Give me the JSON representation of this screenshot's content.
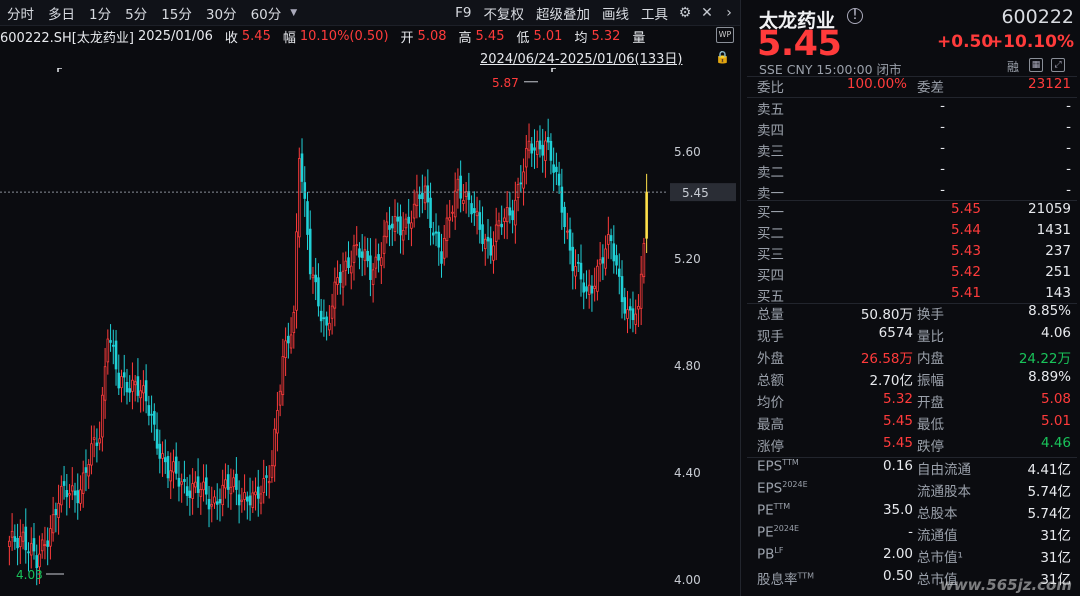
{
  "toolbar": {
    "periods": [
      "分时",
      "多日",
      "1分",
      "5分",
      "15分",
      "30分",
      "60分"
    ],
    "right_items": [
      "F9",
      "不复权",
      "超级叠加",
      "画线",
      "工具"
    ],
    "icons": [
      "gear-icon",
      "close-icon",
      "chevron-right-icon",
      "dropdown-icon"
    ]
  },
  "infobar": {
    "symbol": "600222.SH[太龙药业]",
    "date": "2025/01/06",
    "close_label": "收",
    "close": "5.45",
    "amp_label": "幅",
    "amp": "10.10%(0.50)",
    "open_label": "开",
    "open": "5.08",
    "high_label": "高",
    "high": "5.45",
    "low_label": "低",
    "low": "5.01",
    "avg_label": "均",
    "avg": "5.32",
    "vol_label": "量",
    "wp": "WP"
  },
  "range": "2024/06/24-2025/01/06(133日)",
  "chart_data": {
    "type": "candlestick",
    "symbol": "600222.SH",
    "y_ticks": [
      "5.60",
      "5.20",
      "4.80",
      "4.40",
      "4.00"
    ],
    "ylim": [
      4.0,
      5.87
    ],
    "current_price_label": "5.45",
    "high_label": "5.87",
    "low_label": "4.03",
    "colors": {
      "up": "#ff3b3b",
      "down": "#20d0d6",
      "last": "#ffe14a"
    }
  },
  "quote": {
    "name": "太龙药业",
    "code": "600222",
    "price": "5.45",
    "change": "+0.50",
    "change_pct": "+10.10%",
    "sub": "SSE  CNY  15:00:00  闭市",
    "rong": "融",
    "weibi_label": "委比",
    "weibi": "100.00%",
    "weicha_label": "委差",
    "weicha": "23121",
    "asks": [
      {
        "label": "卖五",
        "price": "-",
        "vol": "-"
      },
      {
        "label": "卖四",
        "price": "-",
        "vol": "-"
      },
      {
        "label": "卖三",
        "price": "-",
        "vol": "-"
      },
      {
        "label": "卖二",
        "price": "-",
        "vol": "-"
      },
      {
        "label": "卖一",
        "price": "-",
        "vol": "-"
      }
    ],
    "bids": [
      {
        "label": "买一",
        "price": "5.45",
        "vol": "21059"
      },
      {
        "label": "买二",
        "price": "5.44",
        "vol": "1431"
      },
      {
        "label": "买三",
        "price": "5.43",
        "vol": "237"
      },
      {
        "label": "买四",
        "price": "5.42",
        "vol": "251"
      },
      {
        "label": "买五",
        "price": "5.41",
        "vol": "143"
      }
    ],
    "stats": [
      {
        "l1": "总量",
        "v1": "50.80万",
        "c1": "white",
        "l2": "换手",
        "v2": "8.85%",
        "c2": "white"
      },
      {
        "l1": "现手",
        "v1": "6574",
        "c1": "white",
        "l2": "量比",
        "v2": "4.06",
        "c2": "white"
      },
      {
        "l1": "外盘",
        "v1": "26.58万",
        "c1": "red",
        "l2": "内盘",
        "v2": "24.22万",
        "c2": "green"
      },
      {
        "l1": "总额",
        "v1": "2.70亿",
        "c1": "white",
        "l2": "振幅",
        "v2": "8.89%",
        "c2": "white"
      },
      {
        "l1": "均价",
        "v1": "5.32",
        "c1": "red",
        "l2": "开盘",
        "v2": "5.08",
        "c2": "red"
      },
      {
        "l1": "最高",
        "v1": "5.45",
        "c1": "red",
        "l2": "最低",
        "v2": "5.01",
        "c2": "red"
      },
      {
        "l1": "涨停",
        "v1": "5.45",
        "c1": "red",
        "l2": "跌停",
        "v2": "4.46",
        "c2": "green"
      }
    ],
    "fundamentals": [
      {
        "l1": "EPS",
        "s1": "TTM",
        "v1": "0.16",
        "l2": "自由流通",
        "v2": "4.41亿"
      },
      {
        "l1": "EPS",
        "s1": "2024E",
        "v1": "",
        "l2": "流通股本",
        "v2": "5.74亿"
      },
      {
        "l1": "PE",
        "s1": "TTM",
        "v1": "35.0",
        "l2": "总股本",
        "v2": "5.74亿"
      },
      {
        "l1": "PE",
        "s1": "2024E",
        "v1": "-",
        "l2": "流通值",
        "v2": "31亿"
      },
      {
        "l1": "PB",
        "s1": "LF",
        "v1": "2.00",
        "l2": "总市值¹",
        "v2": "31亿"
      },
      {
        "l1": "股息率",
        "s1": "TTM",
        "v1": "0.50",
        "l2": "总市值",
        "v2": "31亿"
      }
    ],
    "watermark": "www.565jz.com"
  }
}
